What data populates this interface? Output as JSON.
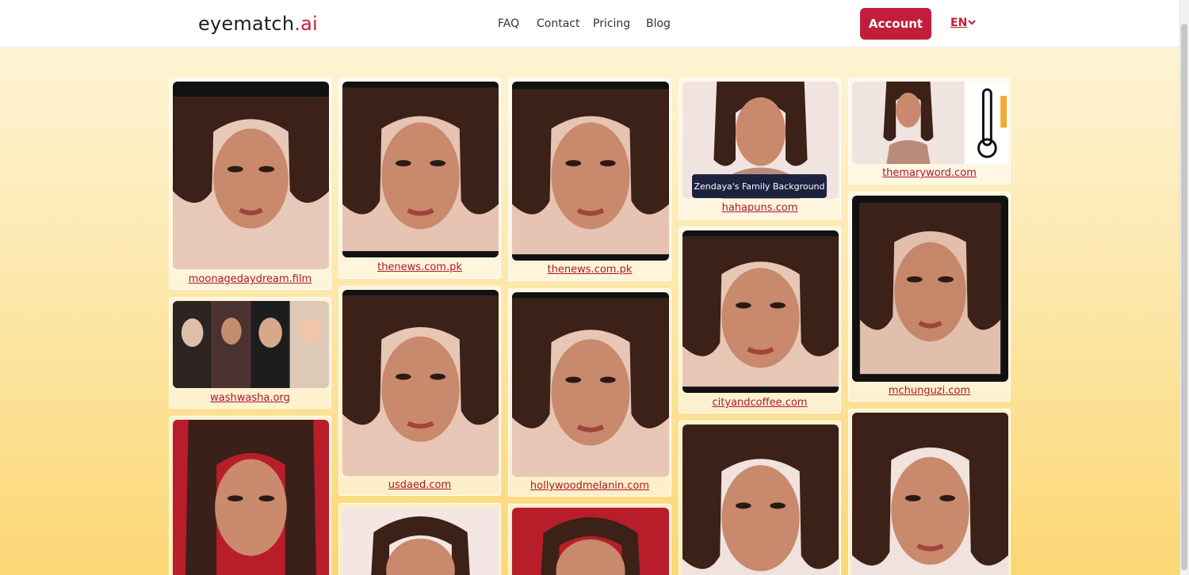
{
  "header": {
    "logo_main": "eyematch",
    "logo_suffix": ".ai",
    "nav": [
      "FAQ",
      "Contact",
      "Pricing",
      "Blog"
    ],
    "account_label": "Account",
    "language": "EN"
  },
  "results": [
    {
      "source": "moonagedaydream.film"
    },
    {
      "source": "washwasha.org"
    },
    {
      "source": ""
    },
    {
      "source": "thenews.com.pk"
    },
    {
      "source": "usdaed.com"
    },
    {
      "source": ""
    },
    {
      "source": "thenews.com.pk"
    },
    {
      "source": "hollywoodmelanin.com"
    },
    {
      "source": ""
    },
    {
      "source": "hahapuns.com"
    },
    {
      "source": "cityandcoffee.com"
    },
    {
      "source": ""
    },
    {
      "source": "themaryword.com"
    },
    {
      "source": "mchunguzi.com"
    },
    {
      "source": ""
    }
  ],
  "tooltip": "Zendaya's Family Background",
  "colors": {
    "accent": "#c21d3a",
    "link": "#b0162f",
    "tooltip_bg": "#1d2240"
  }
}
